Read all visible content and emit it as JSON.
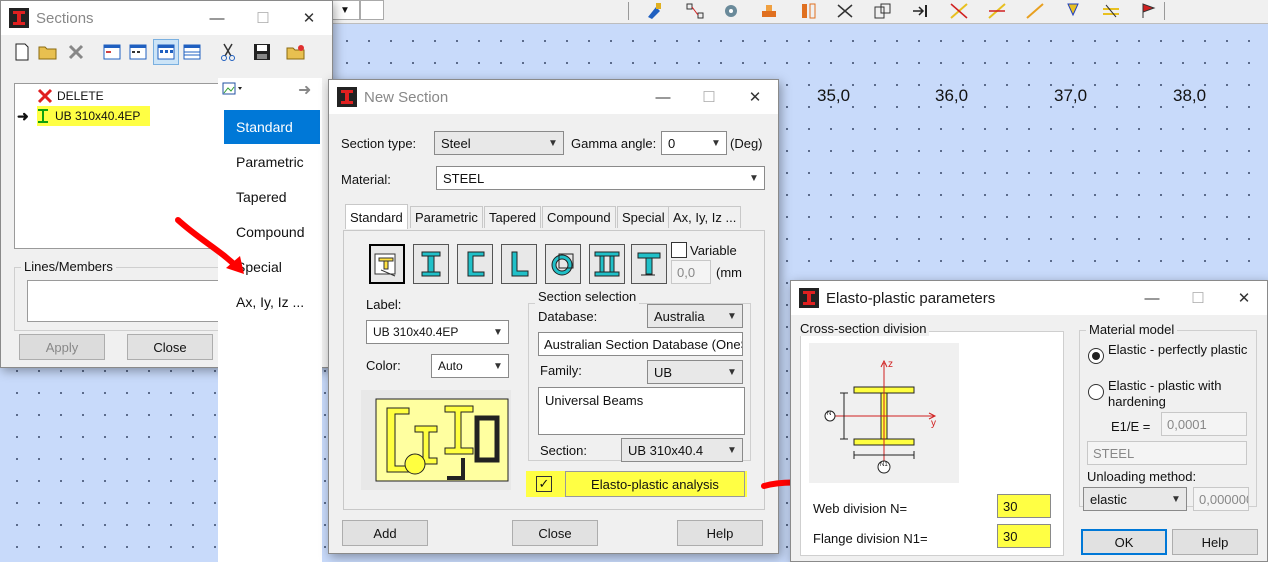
{
  "ruler": {
    "ticks": [
      "35,0",
      "36,0",
      "37,0",
      "38,0"
    ]
  },
  "sections_panel": {
    "title": "Sections",
    "items": [
      {
        "label": "DELETE"
      },
      {
        "label": "UB 310x40.4EP"
      }
    ],
    "lines_members_label": "Lines/Members",
    "apply_label": "Apply",
    "close_label": "Close"
  },
  "type_menu": {
    "items": [
      "Standard",
      "Parametric",
      "Tapered",
      "Compound",
      "Special",
      "Ax, Iy, Iz ..."
    ]
  },
  "new_section": {
    "title": "New Section",
    "section_type_label": "Section type:",
    "section_type_value": "Steel",
    "gamma_label": "Gamma angle:",
    "gamma_value": "0",
    "deg_label": "(Deg)",
    "material_label": "Material:",
    "material_value": "STEEL",
    "tabs": [
      "Standard",
      "Parametric",
      "Tapered",
      "Compound",
      "Special",
      "Ax, Iy, Iz ..."
    ],
    "variable_label": "Variable",
    "variable_value": "0,0",
    "mm_label": "(mm",
    "label_label": "Label:",
    "label_value": "UB 310x40.4EP",
    "color_label": "Color:",
    "color_value": "Auto",
    "section_selection_title": "Section selection",
    "database_label": "Database:",
    "database_value": "Australia",
    "database_full": "Australian Section Database (OneS",
    "family_label": "Family:",
    "family_value": "UB",
    "family_desc": "Universal Beams",
    "section_label": "Section:",
    "section_value": "UB 310x40.4",
    "elasto_label": "Elasto-plastic analysis",
    "elasto_checked": "✓",
    "add_label": "Add",
    "close_label": "Close",
    "help_label": "Help"
  },
  "elasto_dialog": {
    "title": "Elasto-plastic parameters",
    "cross_section_title": "Cross-section division",
    "axis_z": "z",
    "axis_y": "y",
    "marker_n": "N",
    "marker_n1": "N1",
    "web_label": "Web division N=",
    "web_value": "30",
    "flange_label": "Flange division N1=",
    "flange_value": "30",
    "material_model_title": "Material model",
    "radio_1": "Elastic - perfectly plastic",
    "radio_2": "Elastic - plastic with hardening",
    "e1e_label": "E1/E =",
    "e1e_value": "0,0001",
    "material_value": "STEEL",
    "unloading_label": "Unloading method:",
    "unloading_value": "elastic",
    "unloading_extra": "0,000000",
    "ok_label": "OK",
    "help_label": "Help"
  },
  "colors": {
    "highlight": "#ffff44",
    "accent": "#0078d7",
    "annotation": "#ff0000"
  }
}
